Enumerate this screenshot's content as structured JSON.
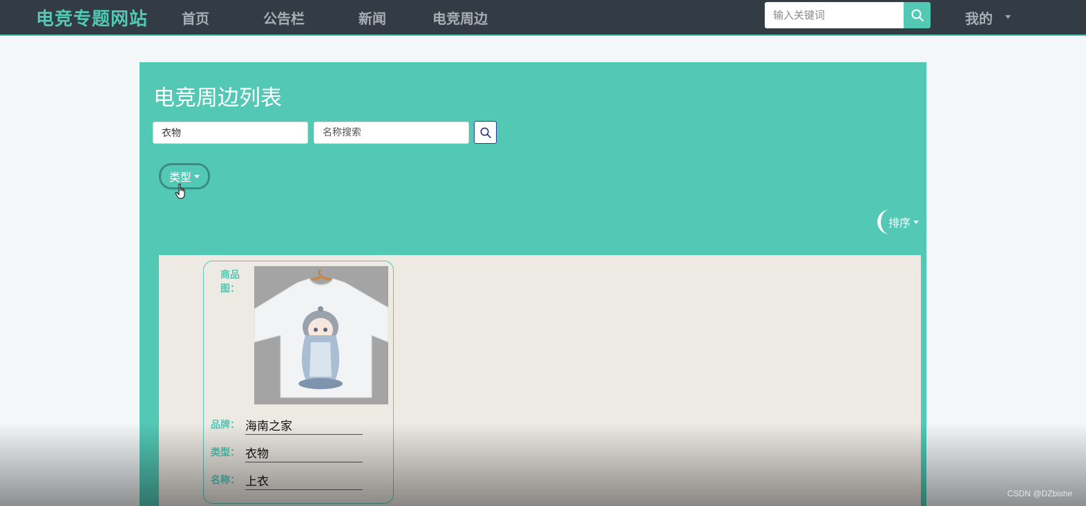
{
  "nav": {
    "brand": "电竞专题网站",
    "items": [
      {
        "label": "首页"
      },
      {
        "label": "公告栏"
      },
      {
        "label": "新闻"
      },
      {
        "label": "电竞周边"
      }
    ],
    "search_placeholder": "输入关键词",
    "search_icon": "search-icon",
    "user_menu_label": "我的"
  },
  "main": {
    "title": "电竞周边列表",
    "filter_type_value": "衣物",
    "name_search_placeholder": "名称搜索",
    "type_dropdown_label": "类型",
    "sort_dropdown_label": "排序"
  },
  "products": [
    {
      "image_label": "商品图：",
      "image_icon": "tshirt-product-image",
      "brand_label": "品牌：",
      "brand": "海南之家",
      "type_label": "类型：",
      "type": "衣物",
      "name_label": "名称：",
      "name": "上衣"
    }
  ],
  "watermark": "CSDN @DZbishe",
  "colors": {
    "accent": "#52c8b5",
    "navbar": "#333b45",
    "list_background": "#ede9e3"
  }
}
